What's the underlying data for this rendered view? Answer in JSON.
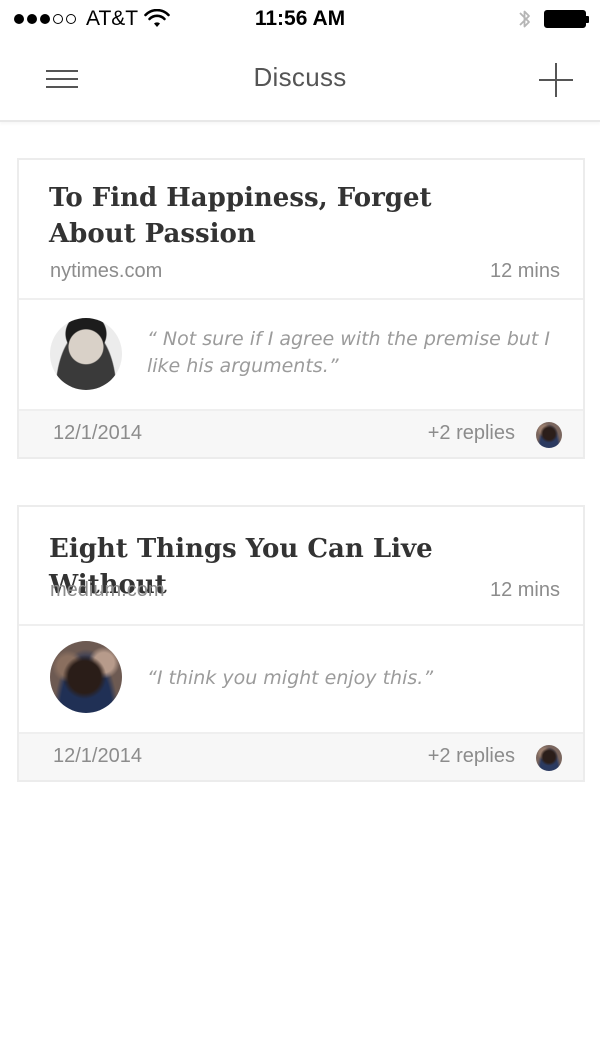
{
  "status_bar": {
    "carrier": "AT&T",
    "time": "11:56 AM",
    "signal_icon": "signal-dots-icon",
    "wifi_icon": "wifi-icon",
    "bluetooth_icon": "bluetooth-icon",
    "battery_icon": "battery-icon"
  },
  "nav": {
    "title": "Discuss",
    "menu_icon": "hamburger-menu-icon",
    "add_icon": "plus-icon"
  },
  "cards": [
    {
      "title": "To Find Happiness, Forget About Passion",
      "source": "nytimes.com",
      "read_time": "12 mins",
      "comment": "“ Not sure if I agree with the premise but I like his arguments.”",
      "date": "12/1/2014",
      "replies": "+2 replies"
    },
    {
      "title": "Eight Things You Can Live Without",
      "source": "medium.com",
      "read_time": "12 mins",
      "comment": "“I think you might enjoy this.”",
      "date": "12/1/2014",
      "replies": "+2 replies"
    }
  ],
  "colors": {
    "text_primary": "#333333",
    "text_muted": "#8c8c8c",
    "comment_text": "#9b9b9b",
    "divider": "#ececec",
    "footer_bg": "#f7f7f7"
  }
}
